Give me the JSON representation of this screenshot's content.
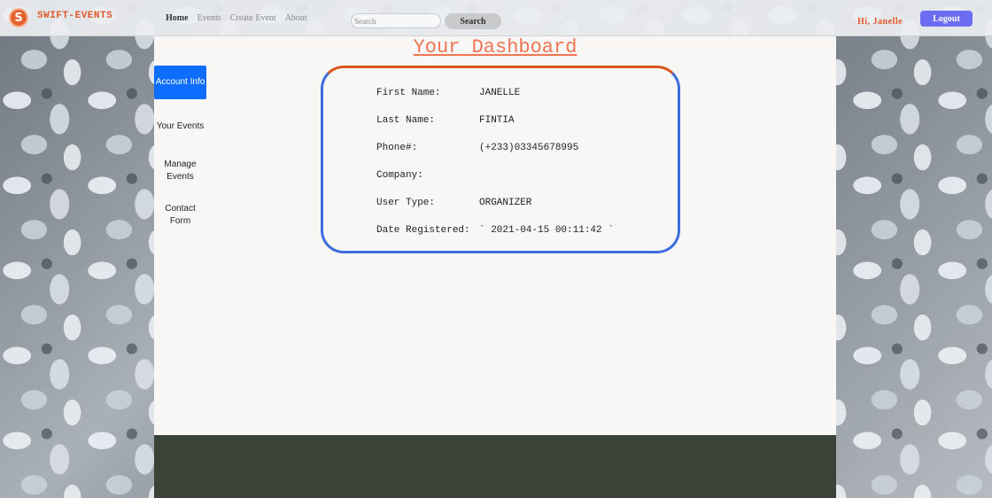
{
  "brand": {
    "logo_letter": "S",
    "name": "SWIFT-EVENTS"
  },
  "nav": {
    "links": [
      {
        "label": "Home",
        "active": true
      },
      {
        "label": "Events",
        "active": false
      },
      {
        "label": "Create Event",
        "active": false
      },
      {
        "label": "About",
        "active": false
      }
    ]
  },
  "search": {
    "placeholder": "Search",
    "button_label": "Search"
  },
  "user": {
    "greeting": "Hi, Janelle",
    "logout_label": "Logout"
  },
  "dashboard": {
    "title": "Your Dashboard"
  },
  "sidebar": {
    "items": [
      {
        "label": "Account Info",
        "active": true
      },
      {
        "label": "Your Events",
        "active": false
      },
      {
        "label": "Manage Events",
        "active": false
      },
      {
        "label": "Contact Form",
        "active": false
      }
    ]
  },
  "account": {
    "rows": [
      {
        "label": "First Name:",
        "value": "JANELLE"
      },
      {
        "label": "Last Name:",
        "value": "FINTIA"
      },
      {
        "label": "Phone#:",
        "value": "(+233)03345678995"
      },
      {
        "label": "Company:",
        "value": ""
      },
      {
        "label": "User Type:",
        "value": "ORGANIZER"
      },
      {
        "label": "Date Registered:",
        "value": "` 2021-04-15 00:11:42 `"
      }
    ]
  },
  "colors": {
    "brand_orange": "#e0582a",
    "title_coral": "#f07552",
    "active_blue": "#0d6efd",
    "logout_purple": "#6b6cf2",
    "card_border_top": "#d9541f",
    "card_border_side": "#3c6ee0",
    "footer": "#3b4238"
  }
}
